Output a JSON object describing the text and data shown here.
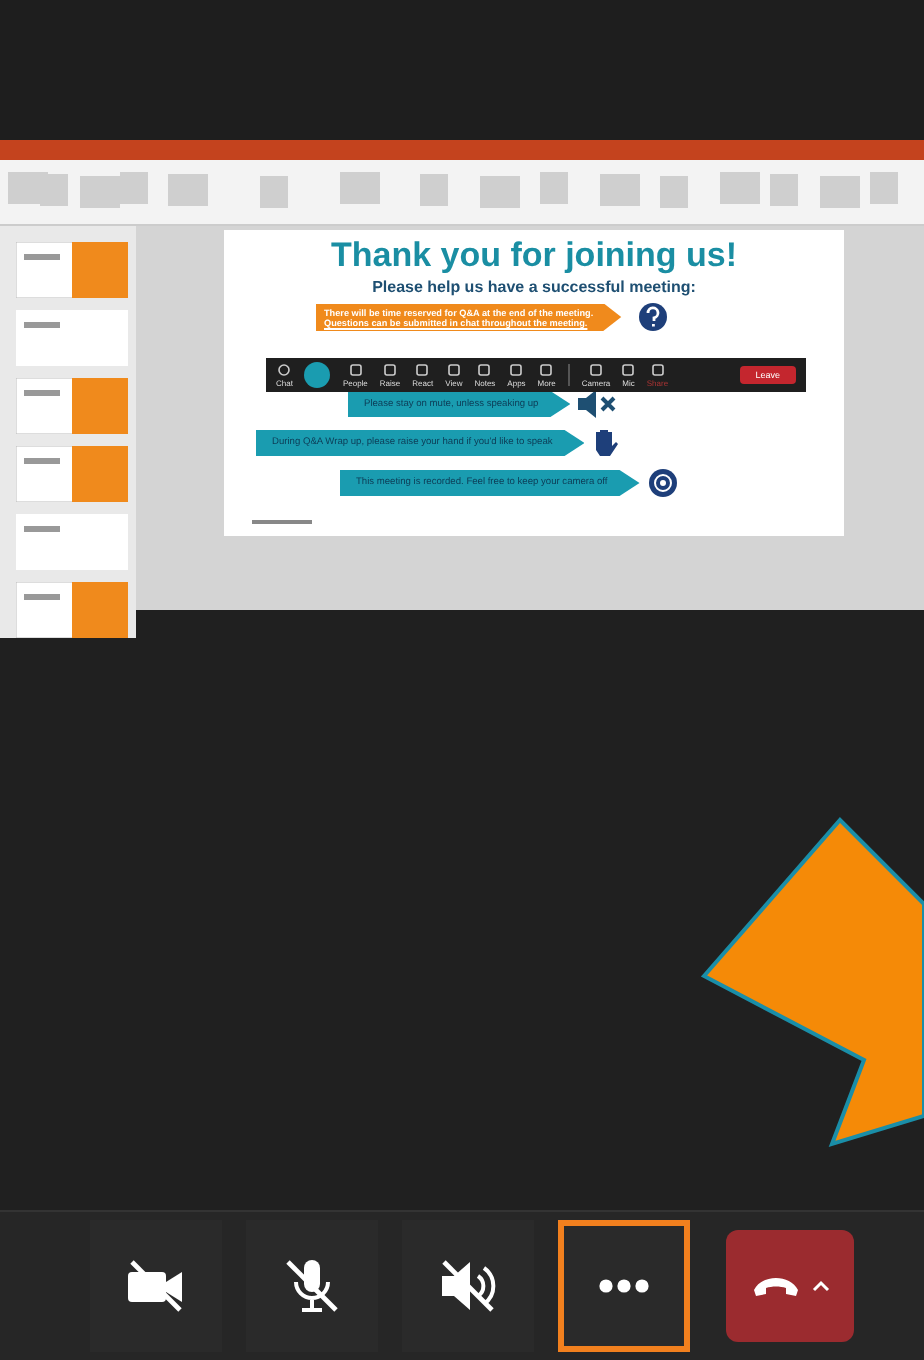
{
  "shared_screen": {
    "slide": {
      "title": "Thank you for joining us!",
      "subtitle": "Please help us have a successful meeting:",
      "notice_lines": [
        "There will be time reserved for Q&A at the end of the meeting.",
        "Questions can be submitted in chat throughout the meeting."
      ],
      "arrows": [
        {
          "text": "Please stay on mute, unless speaking up",
          "kind": "mute"
        },
        {
          "text": "During Q&A Wrap up, please raise your hand if you'd like to speak",
          "kind": "hand"
        },
        {
          "text": "This meeting is recorded. Feel free to keep your camera off",
          "kind": "record"
        }
      ]
    },
    "meeting_toolbar": [
      {
        "label": "Chat",
        "kind": "icon"
      },
      {
        "kind": "avatar"
      },
      {
        "label": "People",
        "kind": "icon"
      },
      {
        "label": "Raise",
        "kind": "icon"
      },
      {
        "label": "React",
        "kind": "icon"
      },
      {
        "label": "View",
        "kind": "icon"
      },
      {
        "label": "Notes",
        "kind": "icon"
      },
      {
        "label": "Apps",
        "kind": "icon"
      },
      {
        "label": "More",
        "kind": "icon"
      },
      {
        "kind": "divider"
      },
      {
        "label": "Camera",
        "kind": "icon"
      },
      {
        "label": "Mic",
        "kind": "icon"
      },
      {
        "label": "Share",
        "kind": "faint"
      },
      {
        "label": "Leave",
        "kind": "leave"
      }
    ]
  },
  "call_controls": [
    {
      "kind": "camera",
      "off": true
    },
    {
      "kind": "mic",
      "off": true
    },
    {
      "kind": "speaker",
      "off": true
    },
    {
      "kind": "more",
      "highlighted": true
    },
    {
      "kind": "hangup"
    }
  ]
}
